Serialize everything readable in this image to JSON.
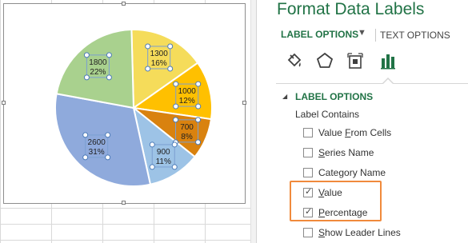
{
  "pane": {
    "title": "Format Data Labels",
    "tabs": {
      "label_options": "LABEL OPTIONS",
      "text_options": "TEXT OPTIONS"
    },
    "dropdown_glyph": "▼",
    "icons": [
      "fill-line-icon",
      "effects-pentagon-icon",
      "size-properties-icon",
      "label-options-bar-icon"
    ],
    "section": {
      "toggle": "◢",
      "title": "LABEL OPTIONS",
      "subtitle": "Label Contains"
    },
    "options": [
      {
        "label": "Value From Cells",
        "underline_index": 6,
        "checked": false
      },
      {
        "label": "Series Name",
        "underline_index": 0,
        "checked": false
      },
      {
        "label": "Category Name",
        "underline_index": 4,
        "checked": false
      },
      {
        "label": "Value",
        "underline_index": 0,
        "checked": true
      },
      {
        "label": "Percentage",
        "underline_index": 0,
        "checked": true
      },
      {
        "label": "Show Leader Lines",
        "underline_index": 0,
        "checked": false
      }
    ],
    "check_glyph": "✓",
    "accent_color": "#217346",
    "highlight_color": "#f08a3c"
  },
  "chart_data": {
    "type": "pie",
    "slices": [
      {
        "value": 1300,
        "percent": "16%",
        "color": "#f5dc5a"
      },
      {
        "value": 1000,
        "percent": "12%",
        "color": "#ffc000"
      },
      {
        "value": 700,
        "percent": "8%",
        "color": "#d9820f"
      },
      {
        "value": 900,
        "percent": "11%",
        "color": "#9dc3e6"
      },
      {
        "value": 2600,
        "percent": "31%",
        "color": "#8faadc"
      },
      {
        "value": 1800,
        "percent": "22%",
        "color": "#a9d18e"
      }
    ],
    "data_labels": [
      {
        "value": "1300",
        "percent": "16%"
      },
      {
        "value": "1000",
        "percent": "12%"
      },
      {
        "value": "700",
        "percent": "8%"
      },
      {
        "value": "900",
        "percent": "11%"
      },
      {
        "value": "2600",
        "percent": "31%"
      },
      {
        "value": "1800",
        "percent": "22%"
      }
    ],
    "selected_labels": true
  }
}
